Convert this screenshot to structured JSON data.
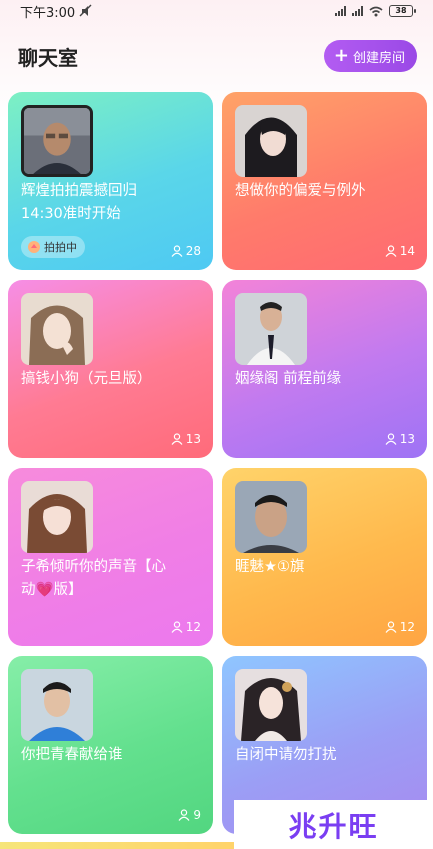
{
  "status_bar": {
    "time": "下午3:00",
    "battery": "38"
  },
  "header": {
    "title": "聊天室",
    "create_button": "创建房间"
  },
  "rooms": [
    {
      "title": "辉煌拍拍震撼回归\n14:30准时开始",
      "badge": "拍拍中",
      "count": "28"
    },
    {
      "title": "想做你的偏爱与例外",
      "count": "14"
    },
    {
      "title": "搞钱小狗（元旦版）",
      "count": "13"
    },
    {
      "title": "姻缘阁 前程前缘",
      "count": "13"
    },
    {
      "title": "子希倾听你的声音【心\n动💗版】",
      "count": "12"
    },
    {
      "title": "睚魅★①旗",
      "count": "12"
    },
    {
      "title": "你把青春献给谁",
      "count": "9"
    },
    {
      "title": "自闭中请勿打扰",
      "count": ""
    }
  ],
  "watermark": "兆升旺",
  "colors": {
    "accent": "#a24fe9"
  },
  "icons": [
    "plus-icon",
    "user-icon",
    "live-badge-icon"
  ]
}
